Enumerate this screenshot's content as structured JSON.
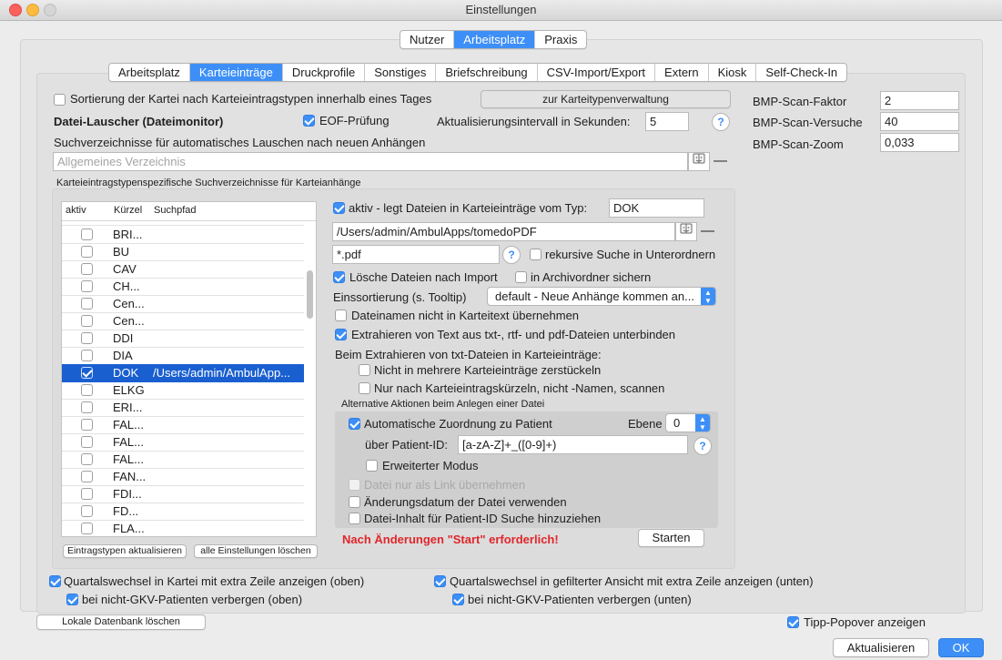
{
  "window": {
    "title": "Einstellungen"
  },
  "top_tabs": [
    {
      "label": "Nutzer",
      "active": false
    },
    {
      "label": "Arbeitsplatz",
      "active": true
    },
    {
      "label": "Praxis",
      "active": false
    }
  ],
  "sub_tabs": [
    {
      "label": "Arbeitsplatz",
      "active": false
    },
    {
      "label": "Karteieinträge",
      "active": true
    },
    {
      "label": "Druckprofile",
      "active": false
    },
    {
      "label": "Sonstiges",
      "active": false
    },
    {
      "label": "Briefschreibung",
      "active": false
    },
    {
      "label": "CSV-Import/Export",
      "active": false
    },
    {
      "label": "Extern",
      "active": false
    },
    {
      "label": "Kiosk",
      "active": false
    },
    {
      "label": "Self-Check-In",
      "active": false
    }
  ],
  "sort_checkbox": {
    "label": "Sortierung der Kartei nach Karteieintragstypen innerhalb eines Tages",
    "checked": false
  },
  "karteitypen_button": "zur Karteitypenverwaltung",
  "datei_lauscher": {
    "heading": "Datei-Lauscher (Dateimonitor)",
    "eof": {
      "label": "EOF-Prüfung",
      "checked": true
    },
    "interval_label": "Aktualisierungsintervall in Sekunden:",
    "interval_value": "5",
    "suchverz_label": "Suchverzeichnisse für automatisches Lauschen nach neuen Anhängen",
    "general_dir_placeholder": "Allgemeines Verzeichnis",
    "typed_section_label": "Karteieintragstypenspezifische Suchverzeichnisse für Karteianhänge"
  },
  "bmp": {
    "faktor": {
      "label": "BMP-Scan-Faktor",
      "value": "2"
    },
    "versuche": {
      "label": "BMP-Scan-Versuche",
      "value": "40"
    },
    "zoom": {
      "label": "BMP-Scan-Zoom",
      "value": "0,033"
    }
  },
  "list": {
    "headers": {
      "aktiv": "aktiv",
      "kuerzel": "Kürzel",
      "pfad": "Suchpfad"
    },
    "rows": [
      {
        "kuerzel": "BRI...",
        "pfad": "",
        "checked": false,
        "selected": false
      },
      {
        "kuerzel": "BU",
        "pfad": "",
        "checked": false,
        "selected": false
      },
      {
        "kuerzel": "CAV",
        "pfad": "",
        "checked": false,
        "selected": false
      },
      {
        "kuerzel": "CH...",
        "pfad": "",
        "checked": false,
        "selected": false
      },
      {
        "kuerzel": "Cen...",
        "pfad": "",
        "checked": false,
        "selected": false
      },
      {
        "kuerzel": "Cen...",
        "pfad": "",
        "checked": false,
        "selected": false
      },
      {
        "kuerzel": "DDI",
        "pfad": "",
        "checked": false,
        "selected": false
      },
      {
        "kuerzel": "DIA",
        "pfad": "",
        "checked": false,
        "selected": false
      },
      {
        "kuerzel": "DOK",
        "pfad": "/Users/admin/AmbulApp...",
        "checked": true,
        "selected": true
      },
      {
        "kuerzel": "ELKG",
        "pfad": "",
        "checked": false,
        "selected": false
      },
      {
        "kuerzel": "ERI...",
        "pfad": "",
        "checked": false,
        "selected": false
      },
      {
        "kuerzel": "FAL...",
        "pfad": "",
        "checked": false,
        "selected": false
      },
      {
        "kuerzel": "FAL...",
        "pfad": "",
        "checked": false,
        "selected": false
      },
      {
        "kuerzel": "FAL...",
        "pfad": "",
        "checked": false,
        "selected": false
      },
      {
        "kuerzel": "FAN...",
        "pfad": "",
        "checked": false,
        "selected": false
      },
      {
        "kuerzel": "FDI...",
        "pfad": "",
        "checked": false,
        "selected": false
      },
      {
        "kuerzel": "FD...",
        "pfad": "",
        "checked": false,
        "selected": false
      },
      {
        "kuerzel": "FLA...",
        "pfad": "",
        "checked": false,
        "selected": false
      }
    ],
    "update_button": "Eintragstypen aktualisieren",
    "delete_button": "alle Einstellungen löschen"
  },
  "detail": {
    "aktiv_label": "aktiv - legt Dateien in Karteieinträge vom Typ:",
    "aktiv_checked": true,
    "typ_value": "DOK",
    "path_value": "/Users/admin/AmbulApps/tomedoPDF",
    "pattern_value": "*.pdf",
    "rekursiv": {
      "label": "rekursive Suche in Unterordnern",
      "checked": false
    },
    "loesche": {
      "label": "Lösche Dateien nach Import",
      "checked": true
    },
    "archiv": {
      "label": "in Archivordner sichern",
      "checked": false
    },
    "einsort_label": "Einssortierung (s. Tooltip)",
    "einsort_value": "default - Neue Anhänge kommen an...",
    "dateinamen": {
      "label": "Dateinamen nicht in Karteitext übernehmen",
      "checked": false
    },
    "extrahieren": {
      "label": "Extrahieren von Text aus txt-, rtf- und pdf-Dateien unterbinden",
      "checked": true
    },
    "txt_heading": "Beim Extrahieren von txt-Dateien in Karteieinträge:",
    "nicht_zerstueckeln": {
      "label": "Nicht in mehrere Karteieinträge zerstückeln",
      "checked": false
    },
    "nur_kuerzel": {
      "label": "Nur nach Karteieintragskürzeln, nicht -Namen, scannen",
      "checked": false
    },
    "alt_heading": "Alternative Aktionen beim Anlegen einer Datei",
    "auto_zuordnung": {
      "label": "Automatische Zuordnung zu Patient",
      "checked": true
    },
    "ebene_label": "Ebene",
    "ebene_value": "0",
    "patient_id_label": "über Patient-ID:",
    "patient_id_value": "[a-zA-Z]+_([0-9]+)",
    "erweitert": {
      "label": "Erweiterter Modus",
      "checked": false
    },
    "link": {
      "label": "Datei nur als Link übernehmen",
      "checked": false
    },
    "aenderungsdatum": {
      "label": "Änderungsdatum der Datei verwenden",
      "checked": false
    },
    "inhalt": {
      "label": "Datei-Inhalt für Patient-ID Suche hinzuziehen",
      "checked": false
    },
    "warning": "Nach Änderungen \"Start\" erforderlich!",
    "start_button": "Starten"
  },
  "bottom": {
    "quartal_kartei": {
      "label": "Quartalswechsel in Kartei mit extra Zeile anzeigen (oben)",
      "checked": true
    },
    "gkv_oben": {
      "label": "bei nicht-GKV-Patienten verbergen (oben)",
      "checked": true
    },
    "quartal_filter": {
      "label": "Quartalswechsel in gefilterter Ansicht mit extra Zeile anzeigen (unten)",
      "checked": true
    },
    "gkv_unten": {
      "label": "bei nicht-GKV-Patienten verbergen (unten)",
      "checked": true
    },
    "lokale_db_button": "Lokale Datenbank löschen",
    "tipp": {
      "label": "Tipp-Popover anzeigen",
      "checked": true
    },
    "aktualisieren_button": "Aktualisieren",
    "ok_button": "OK"
  },
  "colors": {
    "accent": "#3d8ff7",
    "selection": "#1a5fd0",
    "warning": "#e0262b"
  }
}
